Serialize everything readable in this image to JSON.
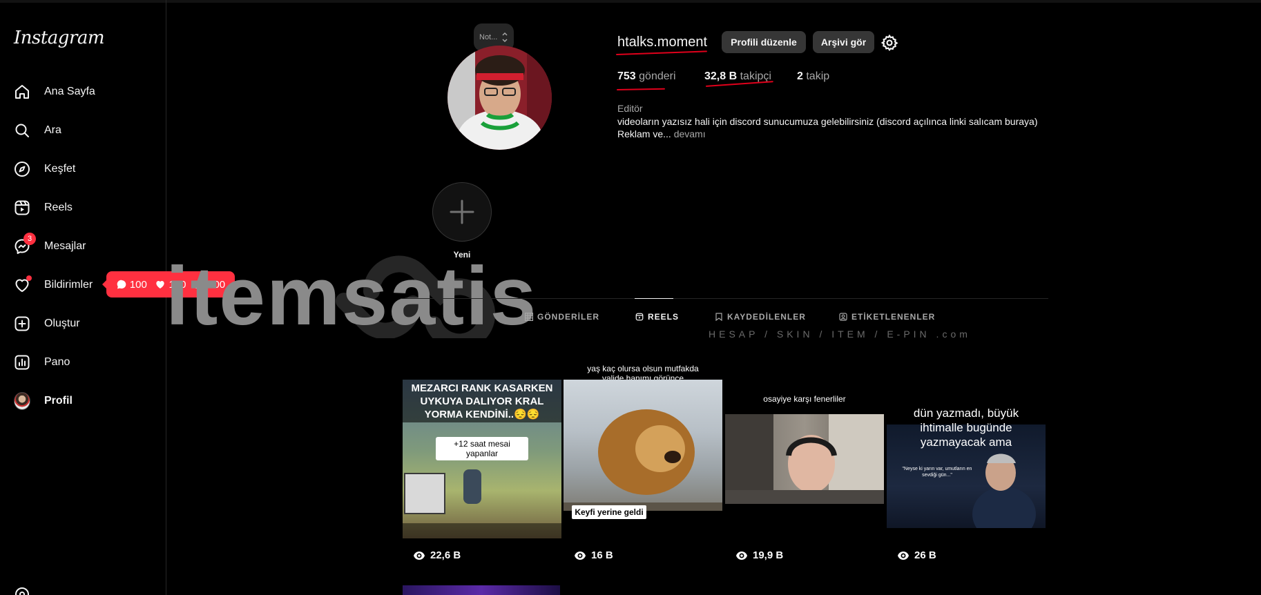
{
  "app": {
    "logo": "Instagram"
  },
  "sidebar": {
    "items": [
      {
        "label": "Ana Sayfa",
        "icon": "home-icon"
      },
      {
        "label": "Ara",
        "icon": "search-icon"
      },
      {
        "label": "Keşfet",
        "icon": "compass-icon"
      },
      {
        "label": "Reels",
        "icon": "reels-icon"
      },
      {
        "label": "Mesajlar",
        "icon": "messenger-icon",
        "badge": "3"
      },
      {
        "label": "Bildirimler",
        "icon": "heart-icon"
      },
      {
        "label": "Oluştur",
        "icon": "plus-square-icon"
      },
      {
        "label": "Pano",
        "icon": "dashboard-icon"
      },
      {
        "label": "Profil",
        "icon": "avatar"
      }
    ],
    "notifications_pill": {
      "comments": "100",
      "likes": "100",
      "follows": "100"
    }
  },
  "profile": {
    "note": "Not...",
    "username": "htalks.moment",
    "edit_button": "Profili düzenle",
    "archive_button": "Arşivi gör",
    "stats": {
      "posts_count": "753",
      "posts_label": "gönderi",
      "followers_count": "32,8 B",
      "followers_label": "takipçi",
      "following_count": "2",
      "following_label": "takip"
    },
    "category": "Editör",
    "bio_line1": "videoların yazısız hali için discord sunucumuza gelebilirsiniz (discord açılınca linki salıcam buraya)",
    "bio_line2": "Reklam ve...",
    "bio_more": "devamı"
  },
  "highlights": {
    "new_label": "Yeni"
  },
  "watermark": {
    "text": "itemsatis",
    "sub": "HESAP / SKIN / ITEM / E-PIN .com"
  },
  "tabs": [
    {
      "label": "GÖNDERİLER",
      "icon": "grid-icon"
    },
    {
      "label": "REELS",
      "icon": "reels-icon",
      "active": true
    },
    {
      "label": "KAYDEDİLENLER",
      "icon": "bookmark-icon"
    },
    {
      "label": "ETİKETLENENLER",
      "icon": "tagged-icon"
    }
  ],
  "reels": [
    {
      "caption_top": "MEZARCI RANK KASARKEN UYKUYA DALIYOR KRAL YORMA KENDİNİ..😔😔",
      "caption_mid": "+12 saat mesai yapanlar",
      "views": "22,6 B"
    },
    {
      "caption_top": "yaş kaç olursa olsun mutfakda valide hanımı görünce",
      "caption_bottom": "Keyfi yerine geldi",
      "views": "16 B"
    },
    {
      "caption_top": "osayiye karşı fenerliler",
      "views": "19,9 B"
    },
    {
      "caption_top": "dün yazmadı, büyük ihtimalle bugünde yazmayacak ama",
      "caption_mid": "\"Neyse ki yarın var, umutların en sevdiği gün...\"",
      "views": "26 B"
    }
  ],
  "colors": {
    "accent_red": "#ff3040",
    "background": "#000000",
    "button": "#363636"
  }
}
